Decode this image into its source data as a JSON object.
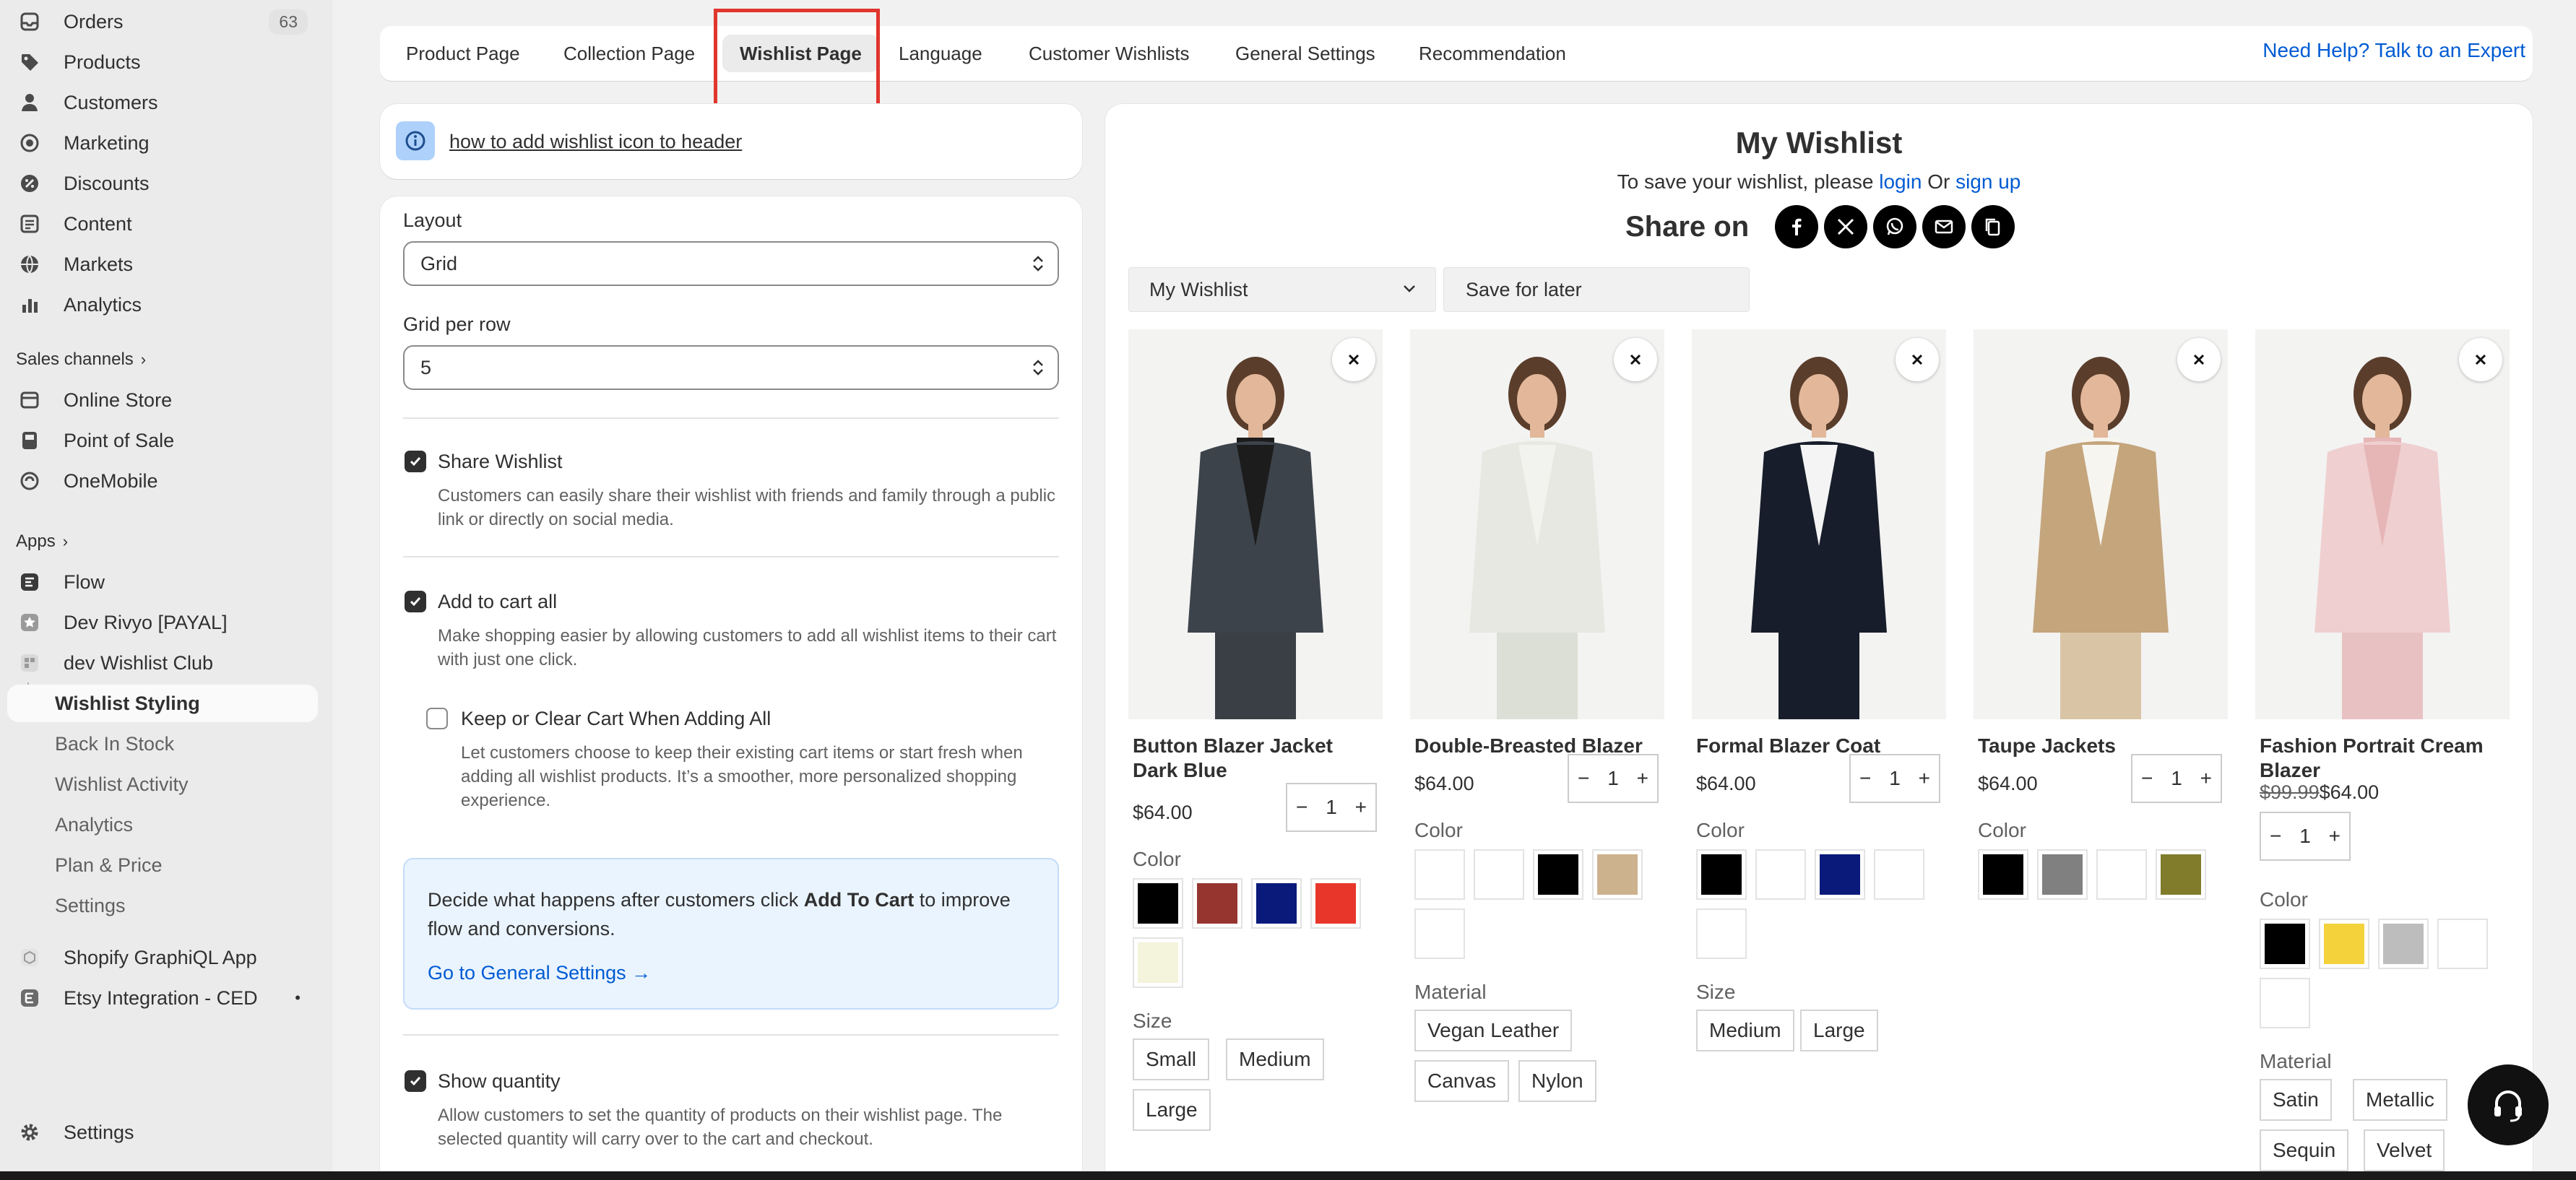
{
  "sidebar": {
    "items": [
      {
        "label": "Orders",
        "badge": "63",
        "icon": "orders-icon"
      },
      {
        "label": "Products",
        "icon": "tag-icon"
      },
      {
        "label": "Customers",
        "icon": "person-icon"
      },
      {
        "label": "Marketing",
        "icon": "target-icon"
      },
      {
        "label": "Discounts",
        "icon": "discount-icon"
      },
      {
        "label": "Content",
        "icon": "content-icon"
      },
      {
        "label": "Markets",
        "icon": "globe-icon"
      },
      {
        "label": "Analytics",
        "icon": "bar-chart-icon"
      }
    ],
    "sales_channels_label": "Sales channels",
    "channels": [
      {
        "label": "Online Store",
        "icon": "store-icon"
      },
      {
        "label": "Point of Sale",
        "icon": "pos-icon"
      },
      {
        "label": "OneMobile",
        "icon": "app-icon"
      }
    ],
    "apps_label": "Apps",
    "apps": [
      {
        "label": "Flow",
        "icon": "flow-icon"
      },
      {
        "label": "Dev Rivyo [PAYAL]",
        "icon": "app-star-icon"
      },
      {
        "label": "dev Wishlist Club",
        "icon": "app-grid-icon"
      }
    ],
    "subitems": [
      {
        "label": "Wishlist Styling",
        "active": true
      },
      {
        "label": "Back In Stock"
      },
      {
        "label": "Wishlist Activity"
      },
      {
        "label": "Analytics"
      },
      {
        "label": "Plan & Price"
      },
      {
        "label": "Settings"
      }
    ],
    "other_apps": [
      {
        "label": "Shopify GraphiQL App",
        "icon": "graphiql-icon"
      },
      {
        "label": "Etsy Integration - CED",
        "icon": "etsy-icon",
        "dot": "•"
      }
    ],
    "settings_label": "Settings"
  },
  "tabs": {
    "items": [
      "Product Page",
      "Collection Page",
      "Wishlist Page",
      "Language",
      "Customer Wishlists",
      "General Settings",
      "Recommendation"
    ],
    "active": "Wishlist Page",
    "help": "Need Help? Talk to an Expert"
  },
  "info": {
    "link": "how to add wishlist icon to header"
  },
  "settings": {
    "layout_label": "Layout",
    "layout_value": "Grid",
    "grid_label": "Grid per row",
    "grid_value": "5",
    "share": {
      "label": "Share Wishlist",
      "checked": true,
      "desc": "Customers can easily share their wishlist with friends and family through a public link or directly on social media."
    },
    "add_all": {
      "label": "Add to cart all",
      "checked": true,
      "desc": "Make shopping easier by allowing customers to add all wishlist items to their cart with just one click."
    },
    "keep_clear": {
      "label": "Keep or Clear Cart When Adding All",
      "checked": false,
      "desc": "Let customers choose to keep their existing cart items or start fresh when adding all wishlist products. It’s a smoother, more personalized shopping experience."
    },
    "callout": {
      "pre": "Decide what happens after customers click ",
      "bold": "Add To Cart",
      "post": " to improve flow and conversions.",
      "link": "Go to General Settings →"
    },
    "show_qty": {
      "label": "Show quantity",
      "checked": true,
      "desc": "Allow customers to set the quantity of products on their wishlist page. The selected quantity will carry over to the cart and checkout."
    }
  },
  "preview": {
    "title": "My Wishlist",
    "save_text": "To save your wishlist, please",
    "login": "login",
    "or": "Or",
    "signup": "sign up",
    "share_label": "Share on",
    "share_icons": [
      "facebook-icon",
      "x-icon",
      "whatsapp-icon",
      "email-icon",
      "copy-icon"
    ],
    "select_value": "My Wishlist",
    "save_later": "Save for later",
    "products": [
      {
        "name": "Button Blazer Jacket Dark Blue",
        "price": "$64.00",
        "qty": "1",
        "jacket": "#3c434b",
        "shirt": "#1c1c1c",
        "pants": "#3a3f46",
        "colors": [
          "#000000",
          "#963530",
          "#0a1a7a",
          "#e8362a",
          "#f4f3dc"
        ],
        "material": [],
        "size": [
          "Small",
          "Medium",
          "Large"
        ]
      },
      {
        "name": "Double-Breasted Blazer",
        "price": "$64.00",
        "qty": "1",
        "jacket": "#e6e8e1",
        "shirt": "#f2f2ee",
        "pants": "#dcdfd6",
        "colors": [
          "#ffffff",
          "#ffffff",
          "#000000",
          "#cdb28e",
          "#ffffff"
        ],
        "material": [
          "Vegan Leather",
          "Canvas",
          "Nylon"
        ],
        "size": []
      },
      {
        "name": "Formal Blazer Coat",
        "price": "$64.00",
        "qty": "1",
        "jacket": "#181d2b",
        "shirt": "#f4f4f4",
        "pants": "#181d2b",
        "colors": [
          "#000000",
          "#ffffff",
          "#0a1a7a",
          "#ffffff",
          "#ffffff"
        ],
        "material": [],
        "size": [
          "Medium",
          "Large"
        ]
      },
      {
        "name": "Taupe Jackets",
        "price": "$64.00",
        "qty": "1",
        "jacket": "#c4a57c",
        "shirt": "#f7f5ef",
        "pants": "#d9c5a6",
        "colors": [
          "#000000",
          "#808080",
          "#ffffff",
          "#807c2c"
        ],
        "material": [],
        "size": []
      },
      {
        "name": "Fashion Portrait Cream Blazer",
        "old_price": "$99.99",
        "price": "$64.00",
        "qty": "1",
        "jacket": "#efcfd0",
        "shirt": "#e6b5b6",
        "pants": "#e8c2c3",
        "colors": [
          "#000000",
          "#f4d23c",
          "#bdbdbd",
          "#ffffff",
          "#ffffff"
        ],
        "material": [
          "Satin",
          "Metallic",
          "Sequin",
          "Velvet"
        ],
        "size": []
      }
    ],
    "color_label": "Color",
    "material_label": "Material",
    "size_label": "Size"
  }
}
